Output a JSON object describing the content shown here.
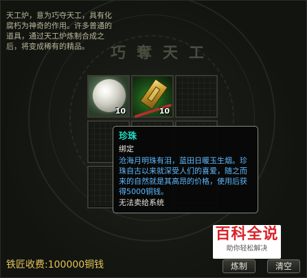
{
  "description": "天工炉，意为巧夺天工，具有化腐朽为神奇的作用。许多普通的道具，通过天工炉炼制合成之后，将变成稀有的精品。",
  "calligraphy": "巧奪天工",
  "slots": [
    {
      "item": "pearl-icon",
      "count": "10"
    },
    {
      "item": "gold-token-icon",
      "count": "10"
    }
  ],
  "tooltip": {
    "title": "珍珠",
    "bind": "绑定",
    "body": "沧海月明珠有泪，蓝田日暖玉生烟。珍珠自古以来就深受人们的喜爱，随之而来的自然就是其高昂的价格，使用后获得5000铜钱。",
    "sell": "无法卖给系统"
  },
  "fee": "铁匠收费:100000铜钱",
  "buttons": {
    "make": "炼制",
    "clear": "清空"
  },
  "watermark": {
    "main": "百科全说",
    "sub": "助你轻松解决"
  },
  "colors": {
    "tooltip_title": "#1fe0c8",
    "tooltip_body": "#5fb8ff",
    "fee": "#e6c45a"
  }
}
